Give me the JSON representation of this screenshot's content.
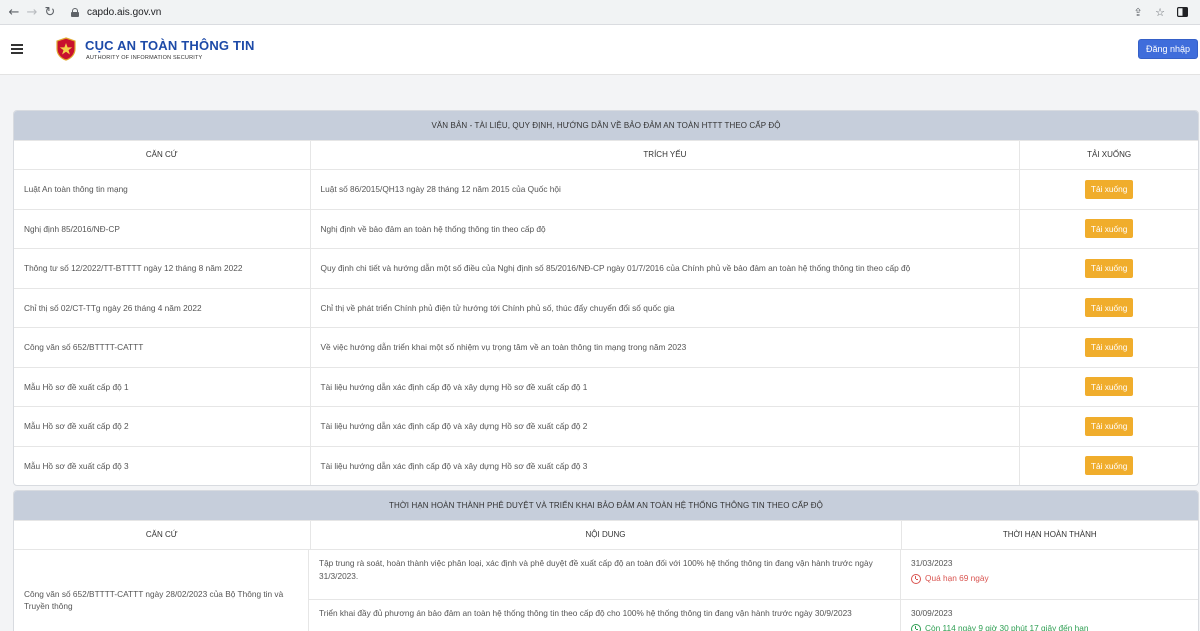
{
  "browser": {
    "url": "capdo.ais.gov.vn"
  },
  "header": {
    "brand_title": "CỤC AN TOÀN THÔNG TIN",
    "brand_subtitle": "AUTHORITY OF INFORMATION SECURITY",
    "login_label": "Đăng nhập",
    "colors": {
      "brand": "#1d4aa8",
      "login_button": "#3f6ddb"
    }
  },
  "documents_panel": {
    "title": "VĂN BẢN - TÀI LIỆU, QUY ĐỊNH, HƯỚNG DẪN VỀ BẢO ĐẢM AN TOÀN HTTT THEO CẤP ĐỘ",
    "columns": [
      "CĂN CỨ",
      "TRÍCH YẾU",
      "TẢI XUỐNG"
    ],
    "download_label": "Tải xuống",
    "rows": [
      {
        "basis": "Luật An toàn thông tin mạng",
        "summary": "Luật số 86/2015/QH13 ngày 28 tháng 12 năm 2015 của Quốc hội"
      },
      {
        "basis": "Nghị định 85/2016/NĐ-CP",
        "summary": "Nghị định về bảo đảm an toàn hệ thống thông tin theo cấp độ"
      },
      {
        "basis": "Thông tư số 12/2022/TT-BTTTT ngày 12 tháng 8 năm 2022",
        "summary": "Quy định chi tiết và hướng dẫn một số điều của Nghị định số 85/2016/NĐ-CP ngày 01/7/2016 của Chính phủ về bảo đảm an toàn hệ thống thông tin theo cấp độ"
      },
      {
        "basis": "Chỉ thị số 02/CT-TTg ngày 26 tháng 4 năm 2022",
        "summary": "Chỉ thị về phát triển Chính phủ điện tử hướng tới Chính phủ số, thúc đẩy chuyển đổi số quốc gia"
      },
      {
        "basis": "Công văn số 652/BTTTT-CATTT",
        "summary": "Về việc hướng dẫn triển khai một số nhiệm vụ trọng tâm về an toàn thông tin mạng trong năm 2023"
      },
      {
        "basis": "Mẫu Hồ sơ đề xuất cấp độ 1",
        "summary": "Tài liệu hướng dẫn xác định cấp độ và xây dựng Hồ sơ đề xuất cấp độ 1"
      },
      {
        "basis": "Mẫu Hồ sơ đề xuất cấp độ 2",
        "summary": "Tài liệu hướng dẫn xác định cấp độ và xây dựng Hồ sơ đề xuất cấp độ 2"
      },
      {
        "basis": "Mẫu Hồ sơ đề xuất cấp độ 3",
        "summary": "Tài liệu hướng dẫn xác định cấp độ và xây dựng Hồ sơ đề xuất cấp độ 3"
      }
    ],
    "colors": {
      "download_button": "#f0ad2c",
      "header_bg": "#c6cedb"
    }
  },
  "deadline_panel": {
    "title": "THỜI HẠN HOÀN THÀNH PHÊ DUYỆT VÀ TRIỂN KHAI BẢO ĐẢM AN TOÀN HỆ THỐNG THÔNG TIN THEO CẤP ĐỘ",
    "columns": [
      "CĂN CỨ",
      "NỘI DUNG",
      "THỜI HẠN HOÀN THÀNH"
    ],
    "basis": "Công văn số 652/BTTTT-CATTT ngày 28/02/2023 của Bộ Thông tin và Truyền thông",
    "items": [
      {
        "content": "Tập trung rà soát, hoàn thành việc phân loại, xác định và phê duyệt đề xuất cấp độ an toàn đối với 100% hệ thống thông tin đang vận hành trước ngày 31/3/2023.",
        "deadline": "31/03/2023",
        "status": "Quá hạn 69 ngày",
        "status_type": "overdue"
      },
      {
        "content": "Triển khai đầy đủ phương án bảo đảm an toàn hệ thống thông tin theo cấp độ cho 100% hệ thống thông tin đang vận hành trước ngày 30/9/2023",
        "deadline": "30/09/2023",
        "status": "Còn 114 ngày 9 giờ 30 phút 17 giây đến hạn",
        "status_type": "remaining"
      }
    ],
    "colors": {
      "overdue": "#d9534f",
      "remaining": "#2e9e52"
    }
  }
}
